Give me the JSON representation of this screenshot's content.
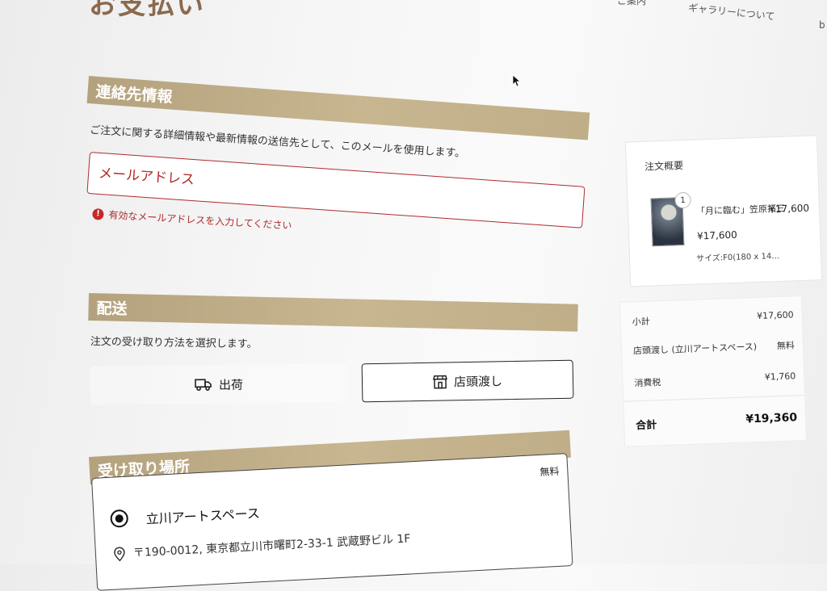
{
  "header": {
    "title": "お支払い",
    "nav": [
      "ご案内",
      "ギャラリーについて",
      "b"
    ]
  },
  "contact": {
    "heading": "連絡先情報",
    "description": "ご注文に関する詳細情報や最新情報の送信先として、このメールを使用します。",
    "email_placeholder": "メールアドレス",
    "error": "有効なメールアドレスを入力してください"
  },
  "delivery": {
    "heading": "配送",
    "description": "注文の受け取り方法を選択します。",
    "ship_label": "出荷",
    "pickup_label": "店頭渡し"
  },
  "pickup": {
    "heading": "受け取り場所",
    "location_name": "立川アートスペース",
    "price": "無料",
    "address": "〒190-0012, 東京都立川市曙町2-33-1 武蔵野ビル 1F"
  },
  "summary": {
    "title": "注文概要",
    "item": {
      "quantity": "1",
      "name": "「月に臨む」笠原拓三",
      "price": "¥17,600",
      "unit_price": "¥17,600",
      "size": "サイズ:F0(180 x 14…"
    },
    "subtotal_label": "小計",
    "subtotal": "¥17,600",
    "shipping_label": "店頭渡し (立川アートスペース)",
    "shipping": "無料",
    "tax_label": "消費税",
    "tax": "¥1,760",
    "total_label": "合計",
    "total": "¥19,360"
  },
  "colors": {
    "section_bar": "#c0ae88",
    "error": "#b02a2a",
    "title": "#8a6a4e"
  }
}
